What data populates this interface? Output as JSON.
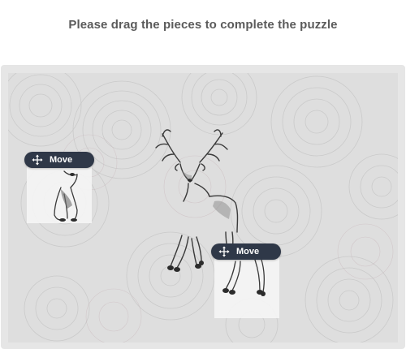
{
  "puzzle": {
    "instruction": "Please drag the pieces to complete the puzzle",
    "board_image": "deer-sketch",
    "pieces": [
      {
        "name": "piece-deer-head",
        "handle_label": "Move",
        "handle_icon": "move-arrows-icon"
      },
      {
        "name": "piece-deer-legs",
        "handle_label": "Move",
        "handle_icon": "move-arrows-icon"
      }
    ],
    "colors": {
      "handle_bg": "#2f3848",
      "handle_text": "#ffffff",
      "board_bg": "#dcdcdc",
      "title_text": "#5b5b5b"
    }
  }
}
